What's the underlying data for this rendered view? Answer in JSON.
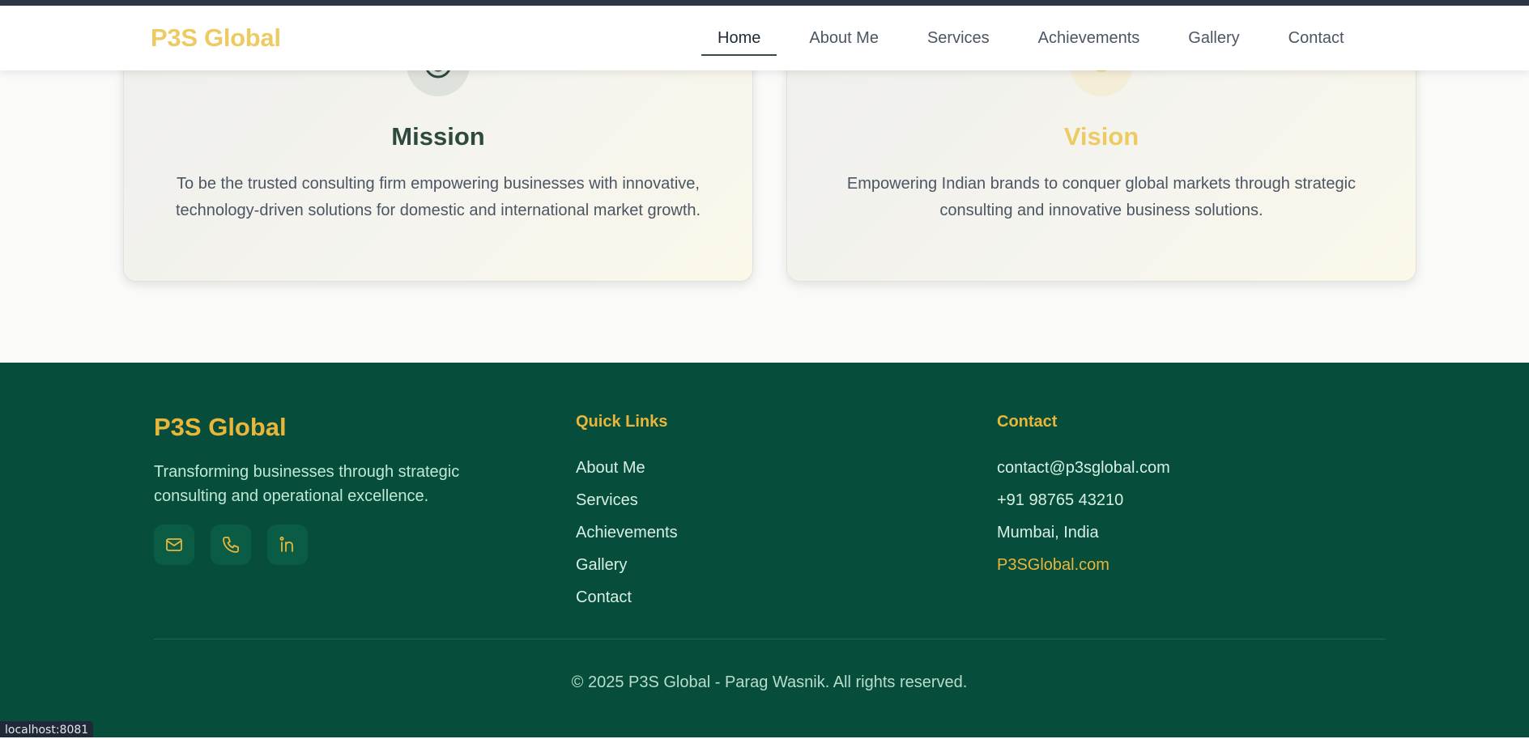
{
  "nav": {
    "brand": "P3S Global",
    "links": [
      "Home",
      "About Me",
      "Services",
      "Achievements",
      "Gallery",
      "Contact"
    ],
    "active": "Home"
  },
  "mission": {
    "title": "Mission",
    "text": "To be the trusted consulting firm empowering businesses with innovative, technology-driven solutions for domestic and international market growth.",
    "icon": "target-icon"
  },
  "vision": {
    "title": "Vision",
    "text": "Empowering Indian brands to conquer global markets through strategic consulting and innovative business solutions.",
    "icon": "eye-icon"
  },
  "footer": {
    "brand": "P3S Global",
    "tagline": "Transforming businesses through strategic consulting and operational excellence.",
    "socials": [
      "mail-icon",
      "phone-icon",
      "linkedin-icon"
    ],
    "quick_links_title": "Quick Links",
    "quick_links": [
      "About Me",
      "Services",
      "Achievements",
      "Gallery",
      "Contact"
    ],
    "contact_title": "Contact",
    "contact": {
      "email": "contact@p3sglobal.com",
      "phone": "+91 98765 43210",
      "location": "Mumbai, India",
      "website": "P3SGlobal.com"
    },
    "copyright": "© 2025 P3S Global - Parag Wasnik. All rights reserved."
  },
  "statusbar": "localhost:8081",
  "colors": {
    "brand_gold": "#edcb64",
    "footer_gold": "#e9b63a",
    "footer_green": "#064e3b",
    "mission_green": "#2e4a3e"
  }
}
